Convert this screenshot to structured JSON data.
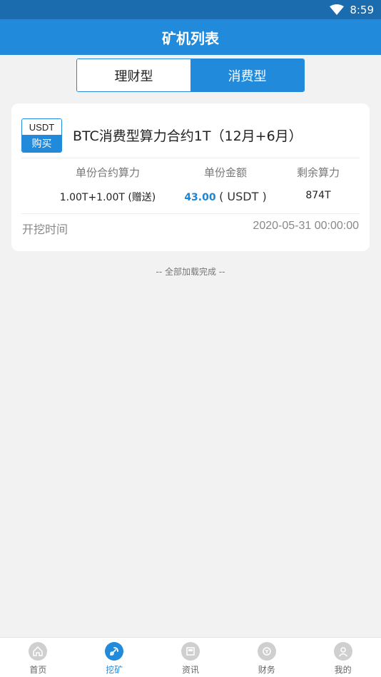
{
  "status_bar": {
    "time": "8:59"
  },
  "header": {
    "title": "矿机列表"
  },
  "segment": {
    "tabs": [
      {
        "label": "理财型",
        "active": false
      },
      {
        "label": "消费型",
        "active": true
      }
    ]
  },
  "card": {
    "badge_currency": "USDT",
    "badge_action": "购买",
    "title": "BTC消费型算力合约1T（12月+6月）",
    "columns": {
      "unit_hashrate_label": "单份合约算力",
      "unit_hashrate_value": "1.00T+1.00T (赠送)",
      "unit_price_label": "单份金额",
      "unit_price_value": "43.00",
      "unit_price_unit": "( USDT )",
      "remaining_label": "剩余算力",
      "remaining_value": "874T"
    },
    "start_label": "开挖时间",
    "start_value": "2020-05-31 00:00:00"
  },
  "list_footer": "-- 全部加载完成 --",
  "tabbar": {
    "items": [
      {
        "label": "首页",
        "icon": "home-icon"
      },
      {
        "label": "挖矿",
        "icon": "mining-icon"
      },
      {
        "label": "资讯",
        "icon": "news-icon"
      },
      {
        "label": "财务",
        "icon": "finance-icon"
      },
      {
        "label": "我的",
        "icon": "profile-icon"
      }
    ]
  },
  "colors": {
    "primary": "#218adb",
    "status_bar": "#1a6cae",
    "price": "#1a86d6"
  }
}
